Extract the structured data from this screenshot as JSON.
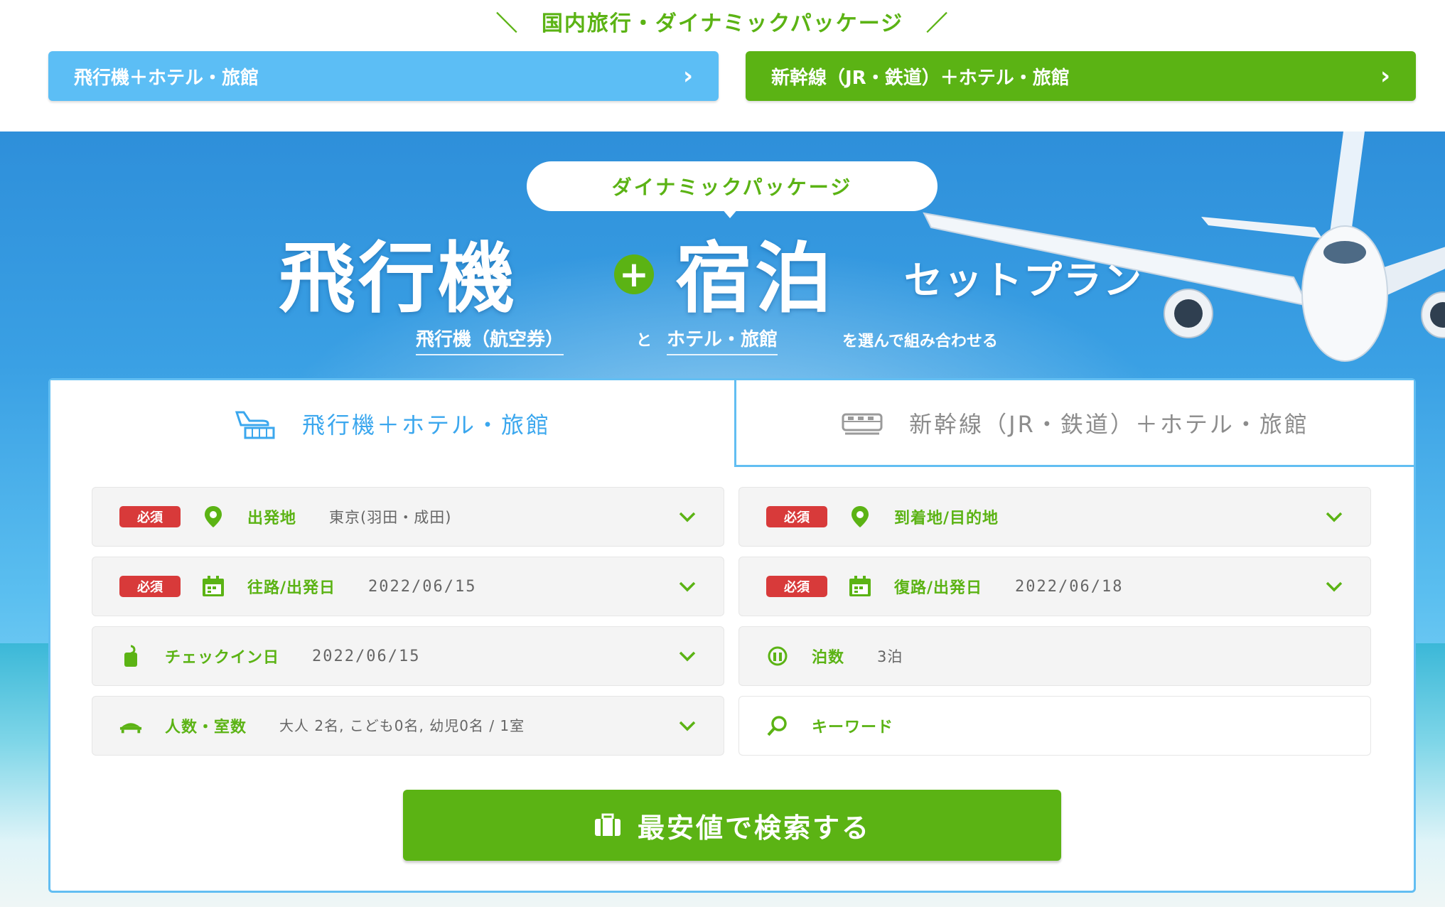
{
  "header": {
    "title": "＼　国内旅行・ダイナミックパッケージ　／",
    "btn_air": "飛行機＋ホテル・旅館",
    "btn_rail": "新幹線（JR・鉄道）＋ホテル・旅館"
  },
  "hero": {
    "pill": "ダイナミックパッケージ",
    "word1": "飛行機",
    "plus": "+",
    "word2": "宿泊",
    "setplan": "セットプラン",
    "sub1": "飛行機（航空券）",
    "sub_and": "と",
    "sub2": "ホテル・旅館",
    "sub_tail": "を選んで組み合わせる"
  },
  "tabs": {
    "air": "飛行機＋ホテル・旅館",
    "rail": "新幹線（JR・鉄道）＋ホテル・旅館"
  },
  "form": {
    "required": "必須",
    "departure_label": "出発地",
    "departure_value": "東京(羽田・成田)",
    "arrival_label": "到着地/目的地",
    "outbound_label": "往路/出発日",
    "outbound_value": "2022/06/15",
    "return_label": "復路/出発日",
    "return_value": "2022/06/18",
    "checkin_label": "チェックイン日",
    "checkin_value": "2022/06/15",
    "nights_label": "泊数",
    "nights_value": "3泊",
    "people_label": "人数・室数",
    "people_value": "大人 2名, こども0名, 幼児0名 / 1室",
    "keyword_placeholder": "キーワード",
    "search_button": "最安値で検索する"
  },
  "colors": {
    "green": "#5bb314",
    "blue": "#5cbef5",
    "tab_active": "#3ba7ee",
    "required_red": "#d83a3a"
  }
}
